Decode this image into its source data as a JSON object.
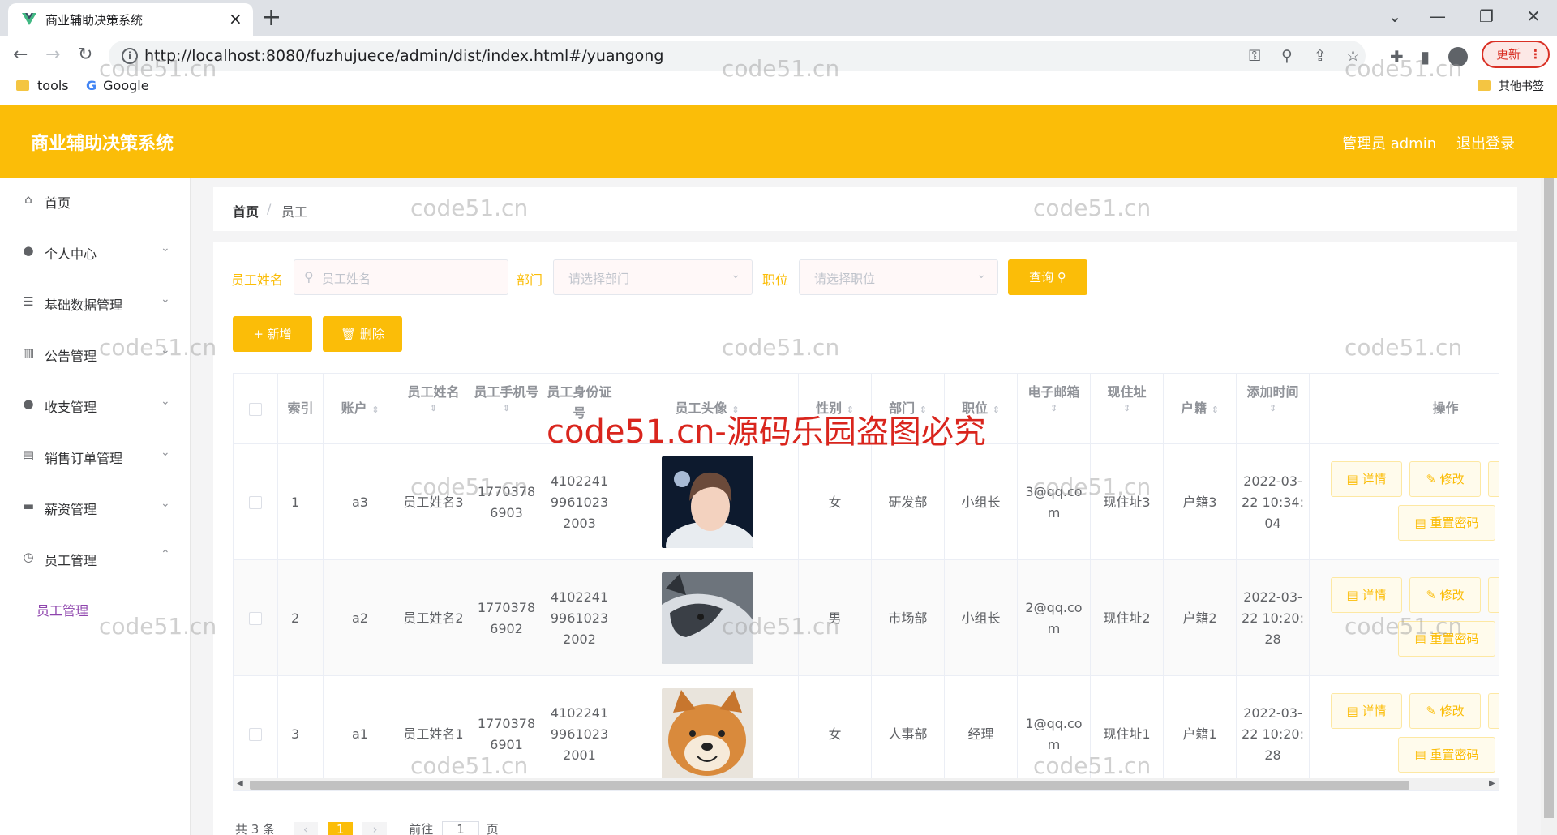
{
  "browser": {
    "tab_title": "商业辅助决策系统",
    "tab_close": "×",
    "new_tab": "+",
    "url": "http://localhost:8080/fuzhujuece/admin/dist/index.html#/yuangong",
    "update_label": "更新",
    "bookmarks": [
      {
        "label": "tools"
      },
      {
        "label": "Google"
      }
    ],
    "other_bookmarks": "其他书签"
  },
  "app": {
    "title": "商业辅助决策系统",
    "user_label": "管理员 admin",
    "logout_label": "退出登录"
  },
  "sidebar": {
    "items": [
      {
        "label": "首页",
        "icon": "home-icon"
      },
      {
        "label": "个人中心",
        "icon": "user-icon"
      },
      {
        "label": "基础数据管理",
        "icon": "list-icon"
      },
      {
        "label": "公告管理",
        "icon": "bar-chart-icon"
      },
      {
        "label": "收支管理",
        "icon": "user-icon"
      },
      {
        "label": "销售订单管理",
        "icon": "order-icon"
      },
      {
        "label": "薪资管理",
        "icon": "wallet-icon"
      },
      {
        "label": "员工管理",
        "icon": "compass-icon"
      }
    ],
    "sub_items": [
      {
        "label": "员工管理"
      }
    ]
  },
  "breadcrumb": {
    "home": "首页",
    "separator": "/",
    "current": "员工"
  },
  "filters": {
    "name_label": "员工姓名",
    "name_placeholder": "员工姓名",
    "dept_label": "部门",
    "dept_placeholder": "请选择部门",
    "position_label": "职位",
    "position_placeholder": "请选择职位",
    "search_button": "查询"
  },
  "actions": {
    "add_button": "+ 新增",
    "delete_button": "删除"
  },
  "table": {
    "headers": {
      "index": "索引",
      "account": "账户",
      "name": "员工姓名",
      "phone": "员工手机号",
      "idcard": "员工身份证号",
      "avatar": "员工头像",
      "gender": "性别",
      "dept": "部门",
      "position": "职位",
      "email": "电子邮箱",
      "address": "现住址",
      "hometown": "户籍",
      "created": "添加时间",
      "ops": "操作"
    },
    "rows": [
      {
        "index": "1",
        "account": "a3",
        "name": "员工姓名3",
        "phone": "17703786903",
        "idcard": "410224199610232003",
        "gender": "女",
        "dept": "研发部",
        "position": "小组长",
        "email": "3@qq.com",
        "address": "现住址3",
        "hometown": "户籍3",
        "created": "2022-03-22 10:34:04"
      },
      {
        "index": "2",
        "account": "a2",
        "name": "员工姓名2",
        "phone": "17703786902",
        "idcard": "410224199610232002",
        "gender": "男",
        "dept": "市场部",
        "position": "小组长",
        "email": "2@qq.com",
        "address": "现住址2",
        "hometown": "户籍2",
        "created": "2022-03-22 10:20:28"
      },
      {
        "index": "3",
        "account": "a1",
        "name": "员工姓名1",
        "phone": "17703786901",
        "idcard": "410224199610232001",
        "gender": "女",
        "dept": "人事部",
        "position": "经理",
        "email": "1@qq.com",
        "address": "现住址1",
        "hometown": "户籍1",
        "created": "2022-03-22 10:20:28"
      }
    ],
    "op_labels": {
      "detail": "详情",
      "edit": "修改",
      "reset": "重置密码"
    }
  },
  "pager": {
    "total": "共 3 条",
    "current_page": "1",
    "goto_prefix": "前往",
    "goto_value": "1",
    "goto_suffix": "页"
  },
  "watermark": {
    "small": "code51.cn",
    "big": "code51.cn-源码乐园盗图必究"
  },
  "colors": {
    "brand": "#fbbd08",
    "watermark_red": "#d9251d"
  }
}
